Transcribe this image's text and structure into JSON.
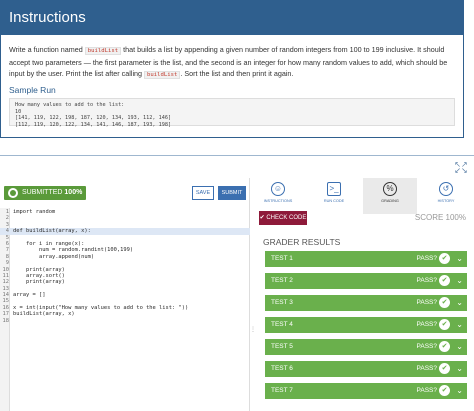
{
  "instructions": {
    "title": "Instructions",
    "desc_before_code1": "Write a function named ",
    "code1": "buildList",
    "desc_after_code1": " that builds a list by appending a given number of random integers from 100 to 199 inclusive. It should accept two parameters — the first parameter is the list, and the second is an integer for how many random values to add, which should be input by the user. Print the list after calling ",
    "code2": "buildList",
    "desc_after_code2": ". Sort the list and then print it again.",
    "sample_run_title": "Sample Run",
    "sample_lines": [
      "How many values to add to the list:",
      "10",
      "[141, 119, 122, 198, 187, 120, 134, 193, 112, 146]",
      "[112, 119, 120, 122, 134, 141, 146, 187, 193, 198]"
    ]
  },
  "editor": {
    "submitted_label": "SUBMITTED",
    "submitted_score": "100%",
    "save_label": "SAVE",
    "submit_label": "SUBMIT",
    "lines": [
      {
        "n": "1",
        "t": "import random",
        "hl": false
      },
      {
        "n": "2",
        "t": "",
        "hl": false
      },
      {
        "n": "3",
        "t": "",
        "hl": false
      },
      {
        "n": "4",
        "t": "def buildList(array, x):",
        "hl": true
      },
      {
        "n": "5",
        "t": "",
        "hl": false
      },
      {
        "n": "6",
        "t": "    for i in range(x):",
        "hl": false
      },
      {
        "n": "7",
        "t": "        num = random.randint(100,199)",
        "hl": false
      },
      {
        "n": "8",
        "t": "        array.append(num)",
        "hl": false
      },
      {
        "n": "9",
        "t": "",
        "hl": false
      },
      {
        "n": "10",
        "t": "    print(array)",
        "hl": false
      },
      {
        "n": "11",
        "t": "    array.sort()",
        "hl": false
      },
      {
        "n": "12",
        "t": "    print(array)",
        "hl": false
      },
      {
        "n": "13",
        "t": "",
        "hl": false
      },
      {
        "n": "14",
        "t": "array = []",
        "hl": false
      },
      {
        "n": "15",
        "t": "",
        "hl": false
      },
      {
        "n": "16",
        "t": "x = int(input(\"How many values to add to the list: \"))",
        "hl": false
      },
      {
        "n": "17",
        "t": "buildList(array, x)",
        "hl": false
      },
      {
        "n": "18",
        "t": "",
        "hl": false
      }
    ]
  },
  "tabs": [
    {
      "label": "INSTRUCTIONS",
      "icon": "☺"
    },
    {
      "label": "RUN CODE",
      "icon": ">_"
    },
    {
      "label": "GRADING",
      "icon": "%"
    },
    {
      "label": "HISTORY",
      "icon": "↺"
    }
  ],
  "grading": {
    "check_code_label": "✔ CHECK CODE",
    "score_label": "SCORE 100%",
    "header": "GRADER RESULTS",
    "tests": [
      {
        "name": "TEST 1",
        "result": "PASS?"
      },
      {
        "name": "TEST 2",
        "result": "PASS?"
      },
      {
        "name": "TEST 3",
        "result": "PASS?"
      },
      {
        "name": "TEST 4",
        "result": "PASS?"
      },
      {
        "name": "TEST 5",
        "result": "PASS?"
      },
      {
        "name": "TEST 6",
        "result": "PASS?"
      },
      {
        "name": "TEST 7",
        "result": "PASS?"
      }
    ]
  },
  "colors": {
    "accent": "#2f5f8e",
    "pass": "#6ab04c",
    "check": "#8e1a3a"
  }
}
